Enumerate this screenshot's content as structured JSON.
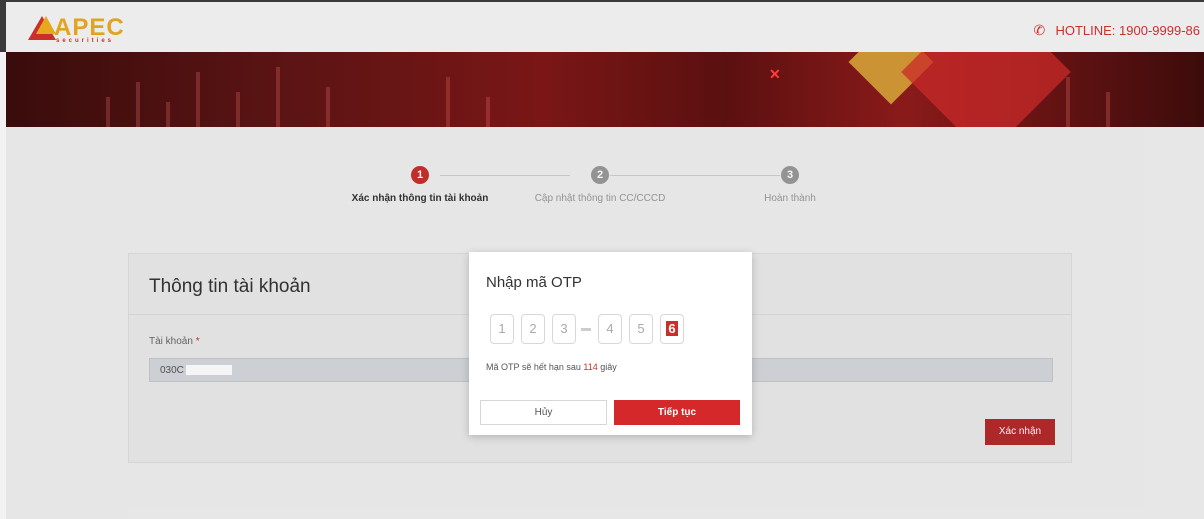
{
  "header": {
    "logo_text": "APEC",
    "logo_sub": "securities",
    "hotline": "HOTLINE: 1900-9999-86"
  },
  "steps": [
    {
      "number": "1",
      "label": "Xác nhận thông tin tài khoản",
      "state": "active"
    },
    {
      "number": "2",
      "label": "Cập nhật thông tin CC/CCCD",
      "state": "inactive"
    },
    {
      "number": "3",
      "label": "Hoàn thành",
      "state": "inactive"
    }
  ],
  "card": {
    "title": "Thông tin tài khoản",
    "account_label": "Tài khoản",
    "required_mark": "*",
    "account_value": "030C",
    "confirm_label": "Xác nhận"
  },
  "modal": {
    "title": "Nhập mã OTP",
    "otp_digits": [
      "1",
      "2",
      "3",
      "4",
      "5",
      "6"
    ],
    "note_prefix": "Mã OTP sẽ hết hạn sau",
    "seconds": "114",
    "note_suffix": "giây",
    "cancel_label": "Hủy",
    "next_label": "Tiếp tục"
  },
  "colors": {
    "accent": "#c9302c",
    "logo_gold": "#e0a421",
    "step_active": "#c9302c",
    "step_inactive": "#9a9a9a"
  }
}
